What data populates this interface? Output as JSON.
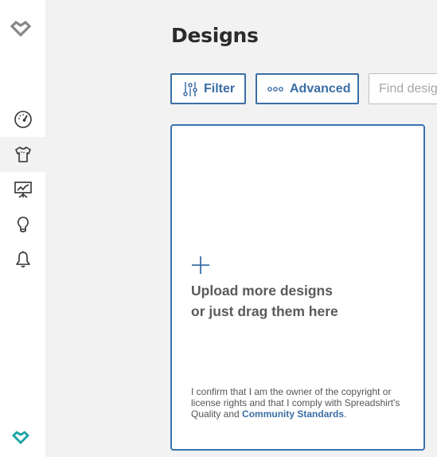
{
  "sidebar": {
    "items": [
      {
        "id": "dashboard",
        "icon": "speedometer-icon",
        "active": false
      },
      {
        "id": "designs",
        "icon": "tshirt-icon",
        "active": true
      },
      {
        "id": "statistics",
        "icon": "presentation-chart-icon",
        "active": false
      },
      {
        "id": "ideas",
        "icon": "lightbulb-icon",
        "active": false
      },
      {
        "id": "notifications",
        "icon": "bell-icon",
        "active": false
      }
    ],
    "logo_color": "#888888",
    "bottom_logo_color": "#1aa3a3"
  },
  "header": {
    "title": "Designs"
  },
  "toolbar": {
    "filter_label": "Filter",
    "advanced_label": "Advanced",
    "search_placeholder": "Find designs",
    "search_value": ""
  },
  "upload": {
    "line1": "Upload more designs",
    "line2": "or just drag them here",
    "legal_text": "I confirm that I am the owner of the copyright or license rights and that I comply with Spreadshirt's Quality and ",
    "legal_link": "Community Standards",
    "legal_end": "."
  },
  "colors": {
    "accent": "#3a6ea5",
    "background": "#f2f2f2"
  }
}
